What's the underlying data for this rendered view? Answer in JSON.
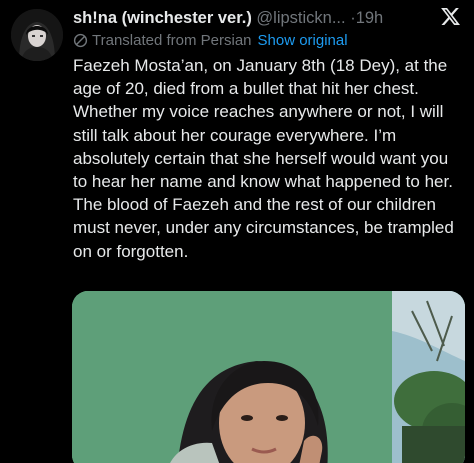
{
  "author": {
    "display_name": "sh!na (winchester ver.)",
    "handle": "@lipstickn...",
    "separator": "·",
    "time": "19h"
  },
  "translation": {
    "label": "Translated from Persian",
    "show_original": "Show original"
  },
  "post": {
    "paragraphs": [
      "Faezeh Mosta’an, on January 8th (18 Dey), at the age of 20, died from a bullet that hit her chest. Whether my voice reaches anywhere or not, I will still talk about her courage everywhere. I’m absolutely certain that she herself would want you to hear her name and know what happened to her.",
      "The blood of Faezeh and the rest of our children must never, under any circumstances, be trampled on or forgotten."
    ]
  },
  "icons": {
    "logo": "x-logo",
    "translation": "globe-icon"
  },
  "colors": {
    "background": "#000000",
    "primary_text": "#e7e9ea",
    "secondary_text": "#71767b",
    "link": "#1d9bf0"
  }
}
